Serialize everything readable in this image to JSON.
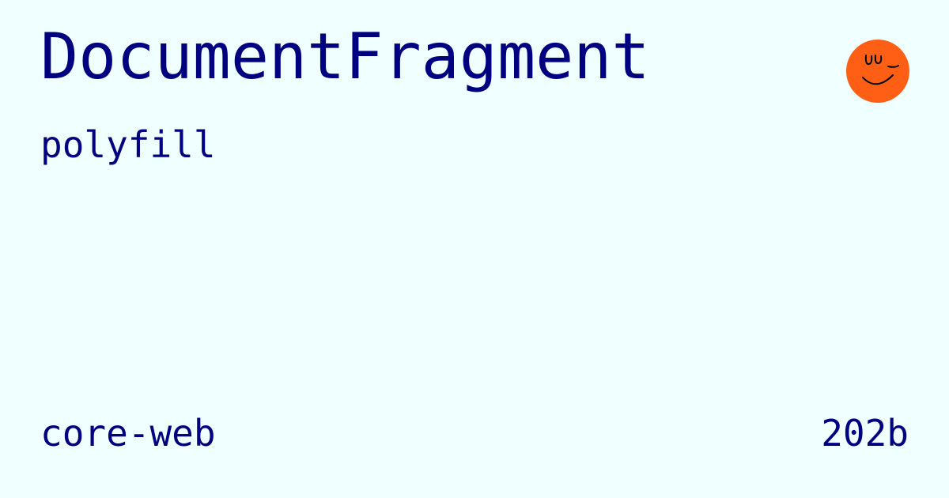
{
  "package": {
    "name": "DocumentFragment",
    "kind": "polyfill",
    "collection": "core-web",
    "size": "202b"
  },
  "logo": {
    "icon": "smiley-face-icon",
    "background_color": "#ff5f15",
    "stroke_color": "#000000"
  },
  "colors": {
    "background": "#f0ffff",
    "text": "#000080"
  }
}
